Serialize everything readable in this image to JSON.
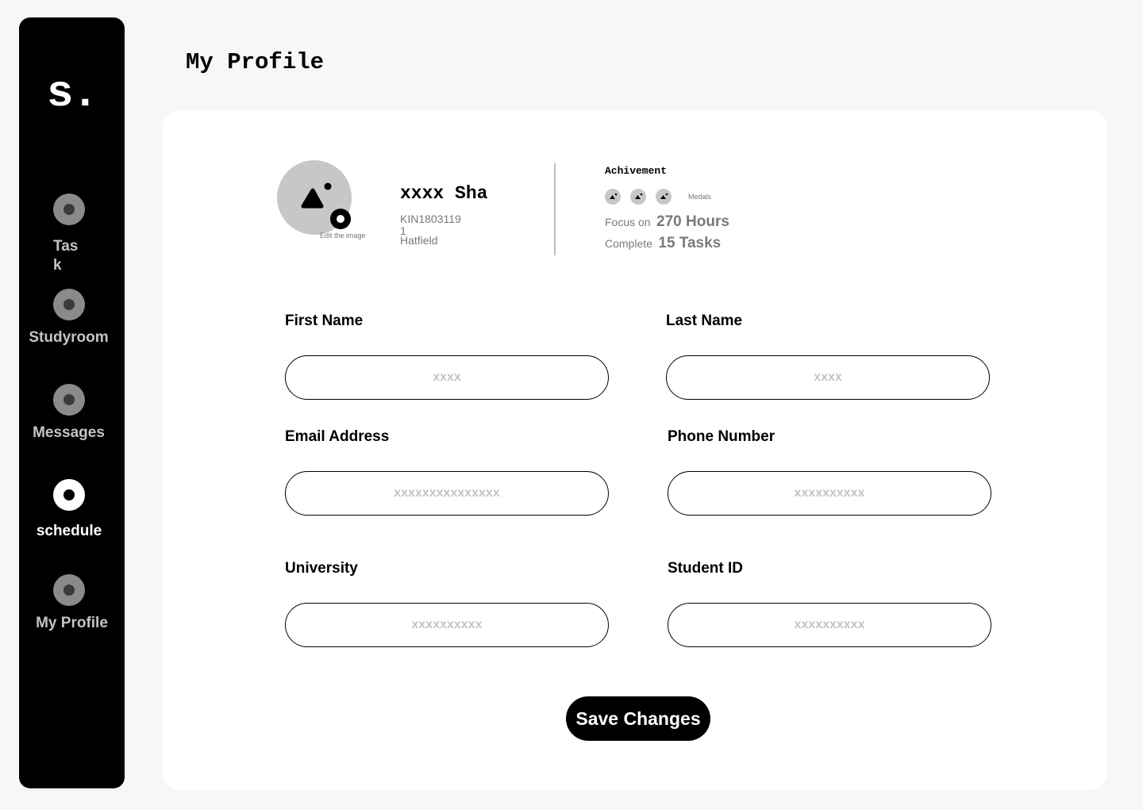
{
  "sidebar": {
    "logo": "s.",
    "items": [
      {
        "label": "Task"
      },
      {
        "label": "Studyroom"
      },
      {
        "label": "Messages"
      },
      {
        "label": "schedule"
      },
      {
        "label": "My Profile"
      }
    ]
  },
  "page": {
    "title": "My Profile"
  },
  "profile": {
    "name": "xxxx Sha",
    "id": "KIN18031191",
    "campus": "Hatfield",
    "edit_caption": "Edit the image",
    "achievement": {
      "title": "Achivement",
      "medals_label": "Medals",
      "medal_count": 3,
      "focus_label": "Focus on",
      "focus_value": "270 Hours",
      "complete_label": "Complete",
      "complete_value": "15 Tasks"
    }
  },
  "form": {
    "first_name": {
      "label": "First Name",
      "placeholder": "xxxx"
    },
    "last_name": {
      "label": "Last Name",
      "placeholder": "xxxx"
    },
    "email": {
      "label": "Email Address",
      "placeholder": "xxxxxxxxxxxxxxx"
    },
    "phone": {
      "label": "Phone Number",
      "placeholder": "xxxxxxxxxx"
    },
    "university": {
      "label": "University",
      "placeholder": "xxxxxxxxxx"
    },
    "student_id": {
      "label": "Student ID",
      "placeholder": "xxxxxxxxxx"
    },
    "save_label": "Save Changes"
  }
}
